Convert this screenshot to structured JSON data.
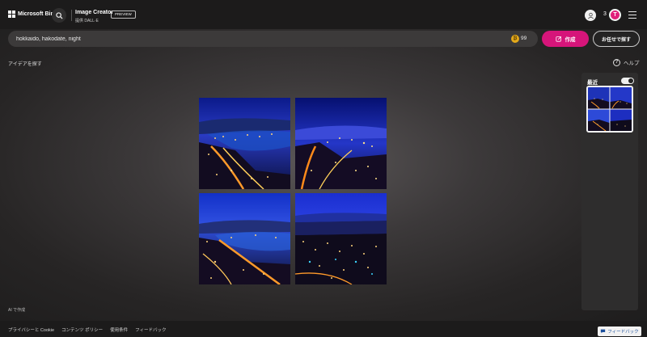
{
  "header": {
    "brand": "Microsoft Bing",
    "app_title": "Image Creator",
    "app_subtitle": "提供 DALL·E",
    "preview_badge": "PREVIEW",
    "coin_count": "3",
    "coin_badge_letter": "T"
  },
  "prompt": {
    "value": "hokkaido, hakodate, night",
    "boost_count": "99",
    "create_label": "作成",
    "surprise_label": "お任せで探す"
  },
  "toolbar": {
    "explore_label": "アイデアを探す",
    "help_label": "ヘルプ"
  },
  "results": {
    "images": [
      "hakodate-night-1",
      "hakodate-night-2",
      "hakodate-night-3",
      "hakodate-night-4"
    ],
    "ai_note": "AI で作成"
  },
  "recent": {
    "title": "最近",
    "toggle_on": true
  },
  "footer": {
    "links": [
      "プライバシーと Cookie",
      "コンテンツ ポリシー",
      "使用条件",
      "フィードバック"
    ],
    "feedback_button": "フィードバック"
  },
  "colors": {
    "accent": "#d6157a",
    "boost": "#e3a91b"
  }
}
